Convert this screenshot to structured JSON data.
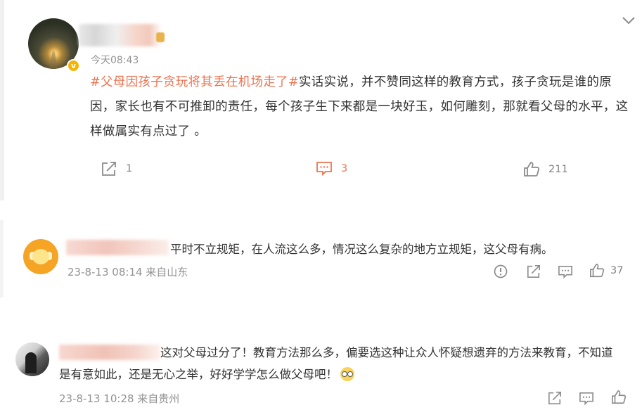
{
  "post": {
    "time": "今天08:43",
    "hashtag": "#父母因孩子贪玩将其丢在机场走了#",
    "body": "实话实说，并不赞同这样的教育方式，孩子贪玩是谁的原因，家长也有不可推卸的责任，每个孩子生下来都是一块好玉，如何雕刻，那就看父母的水平，这样做属实有点过了 。",
    "share_count": "1",
    "comment_count": "3",
    "like_count": "211"
  },
  "comments": [
    {
      "text": "平时不立规矩，在人流这么多，情况这么复杂的地方立规矩，这父母有病。",
      "meta": "23-8-13 08:14 来自山东",
      "like_count": "37"
    },
    {
      "text": "这对父母过分了！教育方法那么多，偏要选这种让众人怀疑想遗弃的方法来教育，不知道是有意如此，还是无心之举，好好学学怎么做父母吧！",
      "meta": "23-8-13 10:28 来自贵州"
    }
  ],
  "icons": {
    "collapse": "chevron-down-icon",
    "share": "share-icon",
    "comment": "comment-icon",
    "like": "thumbs-up-icon",
    "report": "report-icon",
    "emoji": "nerd-glasses-emoji"
  },
  "colors": {
    "accent": "#eb7350",
    "muted": "#939393",
    "text": "#333333",
    "verified": "#f5b400"
  }
}
